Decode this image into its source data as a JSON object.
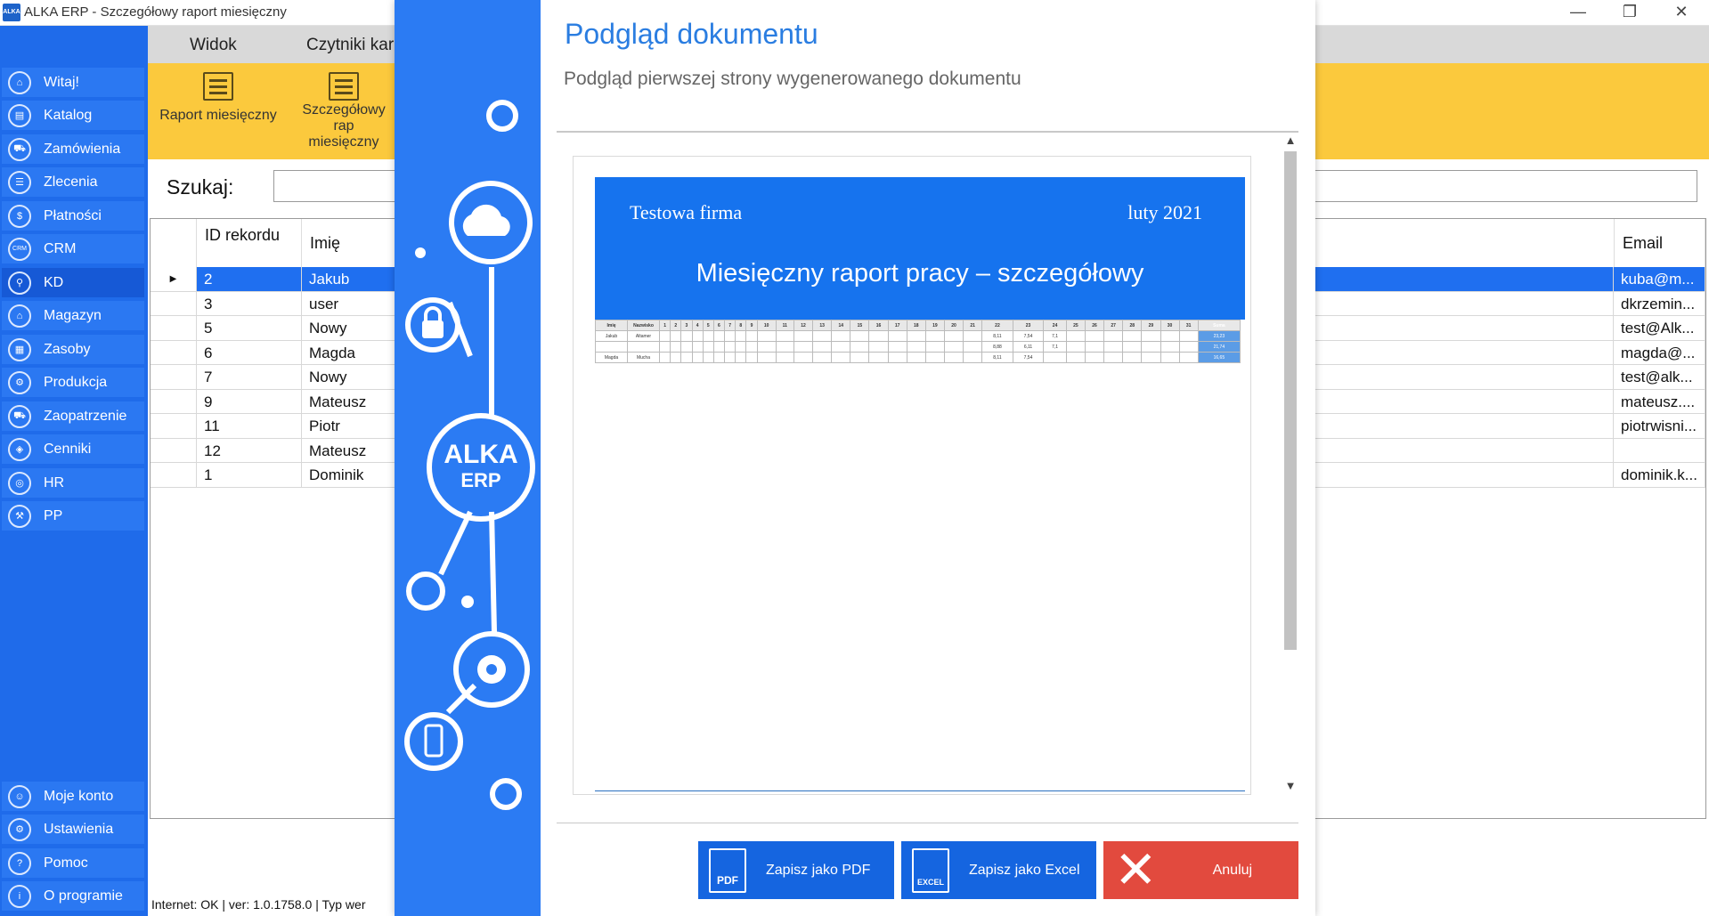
{
  "window": {
    "title": "ALKA ERP - Szczegółowy raport miesięczny",
    "app_icon_text": "ALKA",
    "minimize": "—",
    "maximize": "❐",
    "close": "✕"
  },
  "sidebar": {
    "items": [
      {
        "label": "Witaj!",
        "icon": "⌂"
      },
      {
        "label": "Katalog",
        "icon": "▤"
      },
      {
        "label": "Zamówienia",
        "icon": "⛟"
      },
      {
        "label": "Zlecenia",
        "icon": "☰"
      },
      {
        "label": "Płatności",
        "icon": "$"
      },
      {
        "label": "CRM",
        "icon": "CRM"
      },
      {
        "label": "KD",
        "icon": "⚲"
      },
      {
        "label": "Magazyn",
        "icon": "⌂"
      },
      {
        "label": "Zasoby",
        "icon": "▦"
      },
      {
        "label": "Produkcja",
        "icon": "⚙"
      },
      {
        "label": "Zaopatrzenie",
        "icon": "⛟"
      },
      {
        "label": "Cenniki",
        "icon": "◈"
      },
      {
        "label": "HR",
        "icon": "◎"
      },
      {
        "label": "PP",
        "icon": "⚒"
      }
    ],
    "active": "KD",
    "bottom_items": [
      {
        "label": "Moje konto",
        "icon": "☺"
      },
      {
        "label": "Ustawienia",
        "icon": "⚙"
      },
      {
        "label": "Pomoc",
        "icon": "?"
      },
      {
        "label": "O programie",
        "icon": "i"
      }
    ]
  },
  "ribbon": {
    "tabs": [
      "Widok",
      "Czytniki kar"
    ],
    "buttons": [
      {
        "label": "Raport miesięczny"
      },
      {
        "label": "Szczegółowy rap",
        "label2": "miesięczny"
      }
    ]
  },
  "search": {
    "label": "Szukaj:",
    "value": ""
  },
  "grid": {
    "columns": {
      "id": "ID rekordu",
      "name": "Imię",
      "email": "Email"
    },
    "rows": [
      {
        "id": "2",
        "name": "Jakub",
        "email": "kuba@m..."
      },
      {
        "id": "3",
        "name": "user",
        "email": "dkrzemin..."
      },
      {
        "id": "5",
        "name": "Nowy",
        "email": "test@Alk..."
      },
      {
        "id": "6",
        "name": "Magda",
        "email": "magda@..."
      },
      {
        "id": "7",
        "name": "Nowy",
        "email": "test@alk..."
      },
      {
        "id": "9",
        "name": "Mateusz",
        "email": "mateusz...."
      },
      {
        "id": "11",
        "name": "Piotr",
        "email": "piotrwisni..."
      },
      {
        "id": "12",
        "name": "Mateusz",
        "email": ""
      },
      {
        "id": "1",
        "name": "Dominik",
        "email": "dominik.k..."
      }
    ],
    "selected_row": 0
  },
  "status": {
    "text": "Internet: OK  |   ver: 1.0.1758.0   |   Typ wer"
  },
  "modal": {
    "title": "Podgląd dokumentu",
    "subtitle": "Podgląd pierwszej strony wygenerowanego dokumentu",
    "brand": "ALKA",
    "brand2": "ERP",
    "document": {
      "company": "Testowa firma",
      "date": "luty 2021",
      "report_title": "Miesięczny raport pracy – szczegółowy",
      "table": {
        "headers": [
          "Imię",
          "Nazwisko",
          "1",
          "2",
          "3",
          "4",
          "5",
          "6",
          "7",
          "8",
          "9",
          "10",
          "11",
          "12",
          "13",
          "14",
          "15",
          "16",
          "17",
          "18",
          "19",
          "20",
          "21",
          "22",
          "23",
          "24",
          "25",
          "26",
          "27",
          "28",
          "29",
          "30",
          "31",
          "Suma"
        ],
        "rows": [
          {
            "first": "Jakub",
            "last": "Altamer",
            "d22": "8,11",
            "d23": "7,54",
            "d24": "7,1",
            "sum": "23,23"
          },
          {
            "first": "",
            "last": "",
            "d22": "8,88",
            "d23": "6,11",
            "d24": "7,1",
            "sum": "21,74"
          },
          {
            "first": "Magda",
            "last": "Mucha",
            "d22": "8,11",
            "d23": "7,54",
            "d24": "",
            "sum": "16,65"
          }
        ]
      }
    },
    "buttons": {
      "pdf": "Zapisz jako PDF",
      "pdf_icon": "PDF",
      "excel": "Zapisz jako Excel",
      "excel_icon": "EXCEL",
      "cancel": "Anuluj"
    },
    "colors": {
      "band": "#2b7bf3",
      "pdf_btn": "#1565e0",
      "excel_btn": "#1565e0",
      "cancel_btn": "#e24a3e"
    }
  }
}
